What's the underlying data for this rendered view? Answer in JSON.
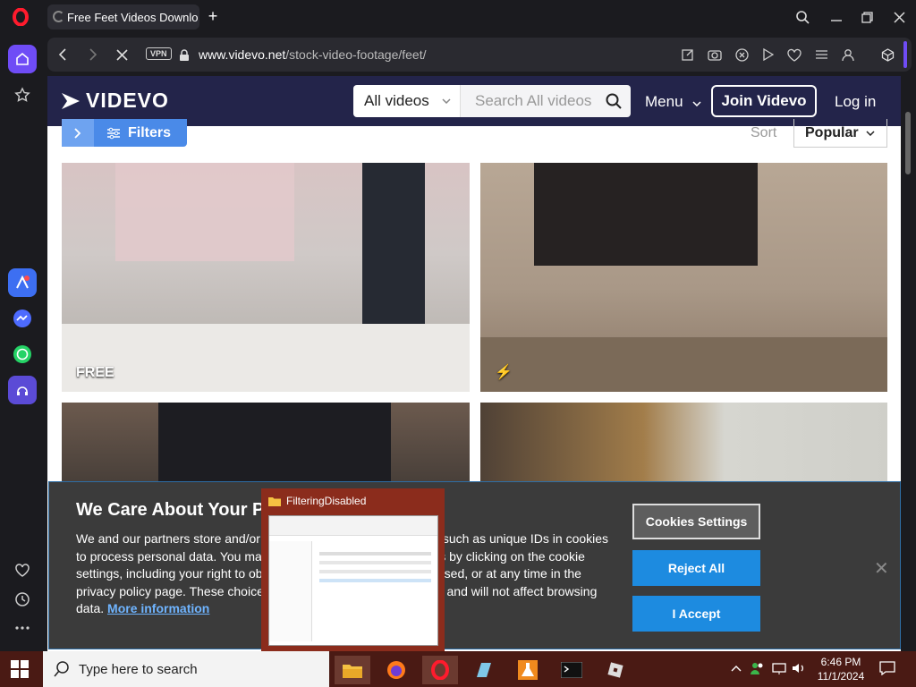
{
  "browser": {
    "tab_title": "Free Feet Videos Downlo",
    "vpn_label": "VPN",
    "url_host": "www.videvo.net",
    "url_path": "/stock-video-footage/feet/"
  },
  "site": {
    "brand": "VIDEVO",
    "category_select": "All videos",
    "search_placeholder": "Search All videos",
    "menu_label": "Menu",
    "join_label": "Join Videvo",
    "login_label": "Log in",
    "filters_label": "Filters",
    "sort_label": "Sort",
    "sort_value": "Popular"
  },
  "videos": [
    {
      "badge": "FREE"
    },
    {
      "badge": "⚡"
    },
    {
      "badge": ""
    },
    {
      "badge": ""
    }
  ],
  "cookie": {
    "title": "We Care About Your Privacy",
    "text": "We and our partners store and/or access information on a device, such as unique IDs in cookies to process personal data. You may accept or manage your choices by clicking on the cookie settings, including your right to object where legitimate interest is used, or at any time in the privacy policy page. These choices will be signaled to our partners and will not affect browsing data.",
    "more_link": "More information",
    "settings_label": "Cookies Settings",
    "reject_label": "Reject All",
    "accept_label": "I Accept"
  },
  "preview": {
    "title": "FilteringDisabled"
  },
  "taskbar": {
    "search_placeholder": "Type here to search",
    "time": "6:46 PM",
    "date": "11/1/2024"
  },
  "colors": {
    "header_bg": "#23244a",
    "accent_blue": "#1d8be0",
    "taskbar_bg": "#4a1a14"
  }
}
